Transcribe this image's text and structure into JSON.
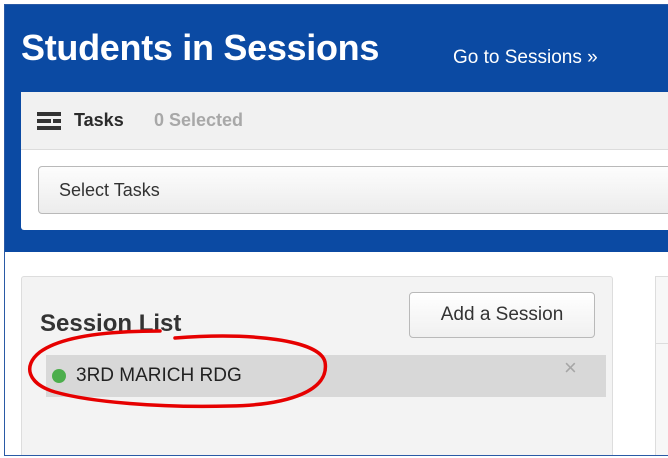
{
  "header": {
    "title": "Students in Sessions",
    "goto_link": "Go to Sessions »"
  },
  "tasks": {
    "icon": "list-icon",
    "label": "Tasks",
    "selected_count": "0 Selected",
    "select_placeholder": "Select Tasks"
  },
  "session_list": {
    "title": "Session List",
    "add_button": "Add a Session",
    "sessions": [
      {
        "name": "3RD MARICH RDG",
        "status_color": "#4cae4c",
        "remove_icon": "×"
      }
    ]
  },
  "colors": {
    "banner": "#0b4aa3",
    "annotation_circle": "#e60000"
  }
}
